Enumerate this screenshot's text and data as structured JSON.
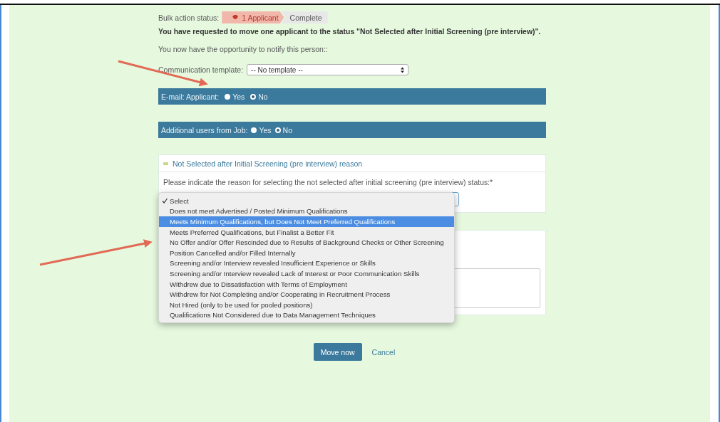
{
  "bulk_status": {
    "label": "Bulk action status:",
    "steps": [
      {
        "label": "1 Applicant",
        "current": true
      },
      {
        "label": "Complete",
        "current": false
      }
    ]
  },
  "confirmation": "You have requested to move one applicant to the status \"Not Selected after Initial Screening (pre interview)\".",
  "notify_text": "You now have the opportunity to notify this person::",
  "communication_template": {
    "label": "Communication template:",
    "value": "-- No template --"
  },
  "option_bars": [
    {
      "label": "E-mail: Applicant:",
      "options": [
        {
          "label": "Yes",
          "selected": false
        },
        {
          "label": "No",
          "selected": true
        }
      ]
    },
    {
      "label": "Additional users from Job:",
      "options": [
        {
          "label": "Yes",
          "selected": false
        },
        {
          "label": "No",
          "selected": true
        }
      ]
    }
  ],
  "reason_panel": {
    "title": "Not Selected after Initial Screening (pre interview) reason",
    "prompt": "Please indicate the reason for selecting the not selected after initial screening (pre interview) status:*",
    "expanded": true
  },
  "reason_dropdown": {
    "options": [
      {
        "label": "Select",
        "checked": true,
        "highlighted": false
      },
      {
        "label": "Does not meet Advertised / Posted Minimum Qualifications",
        "checked": false,
        "highlighted": false
      },
      {
        "label": "Meets Minimum Qualifications, but Does Not Meet Preferred Qualifications",
        "checked": false,
        "highlighted": true
      },
      {
        "label": "Meets Preferred Qualifications, but Finalist a Better Fit",
        "checked": false,
        "highlighted": false
      },
      {
        "label": "No Offer and/or Offer Rescinded due to Results of Background Checks or Other Screening",
        "checked": false,
        "highlighted": false
      },
      {
        "label": "Position Cancelled and/or Filled Internally",
        "checked": false,
        "highlighted": false
      },
      {
        "label": "Screening and/or Interview revealed Insufficient Experience or Skills",
        "checked": false,
        "highlighted": false
      },
      {
        "label": "Screening and/or Interview revealed Lack of Interest or Poor Communication Skills",
        "checked": false,
        "highlighted": false
      },
      {
        "label": "Withdrew due to Dissatisfaction with Terms of Employment",
        "checked": false,
        "highlighted": false
      },
      {
        "label": "Withdrew for Not Completing and/or Cooperating in Recruitment Process",
        "checked": false,
        "highlighted": false
      },
      {
        "label": "Not Hired (only to be used for pooled positions)",
        "checked": false,
        "highlighted": false
      },
      {
        "label": "Qualifications Not Considered due to Data Management Techniques",
        "checked": false,
        "highlighted": false
      }
    ]
  },
  "actions": {
    "primary": "Move now",
    "cancel": "Cancel"
  }
}
